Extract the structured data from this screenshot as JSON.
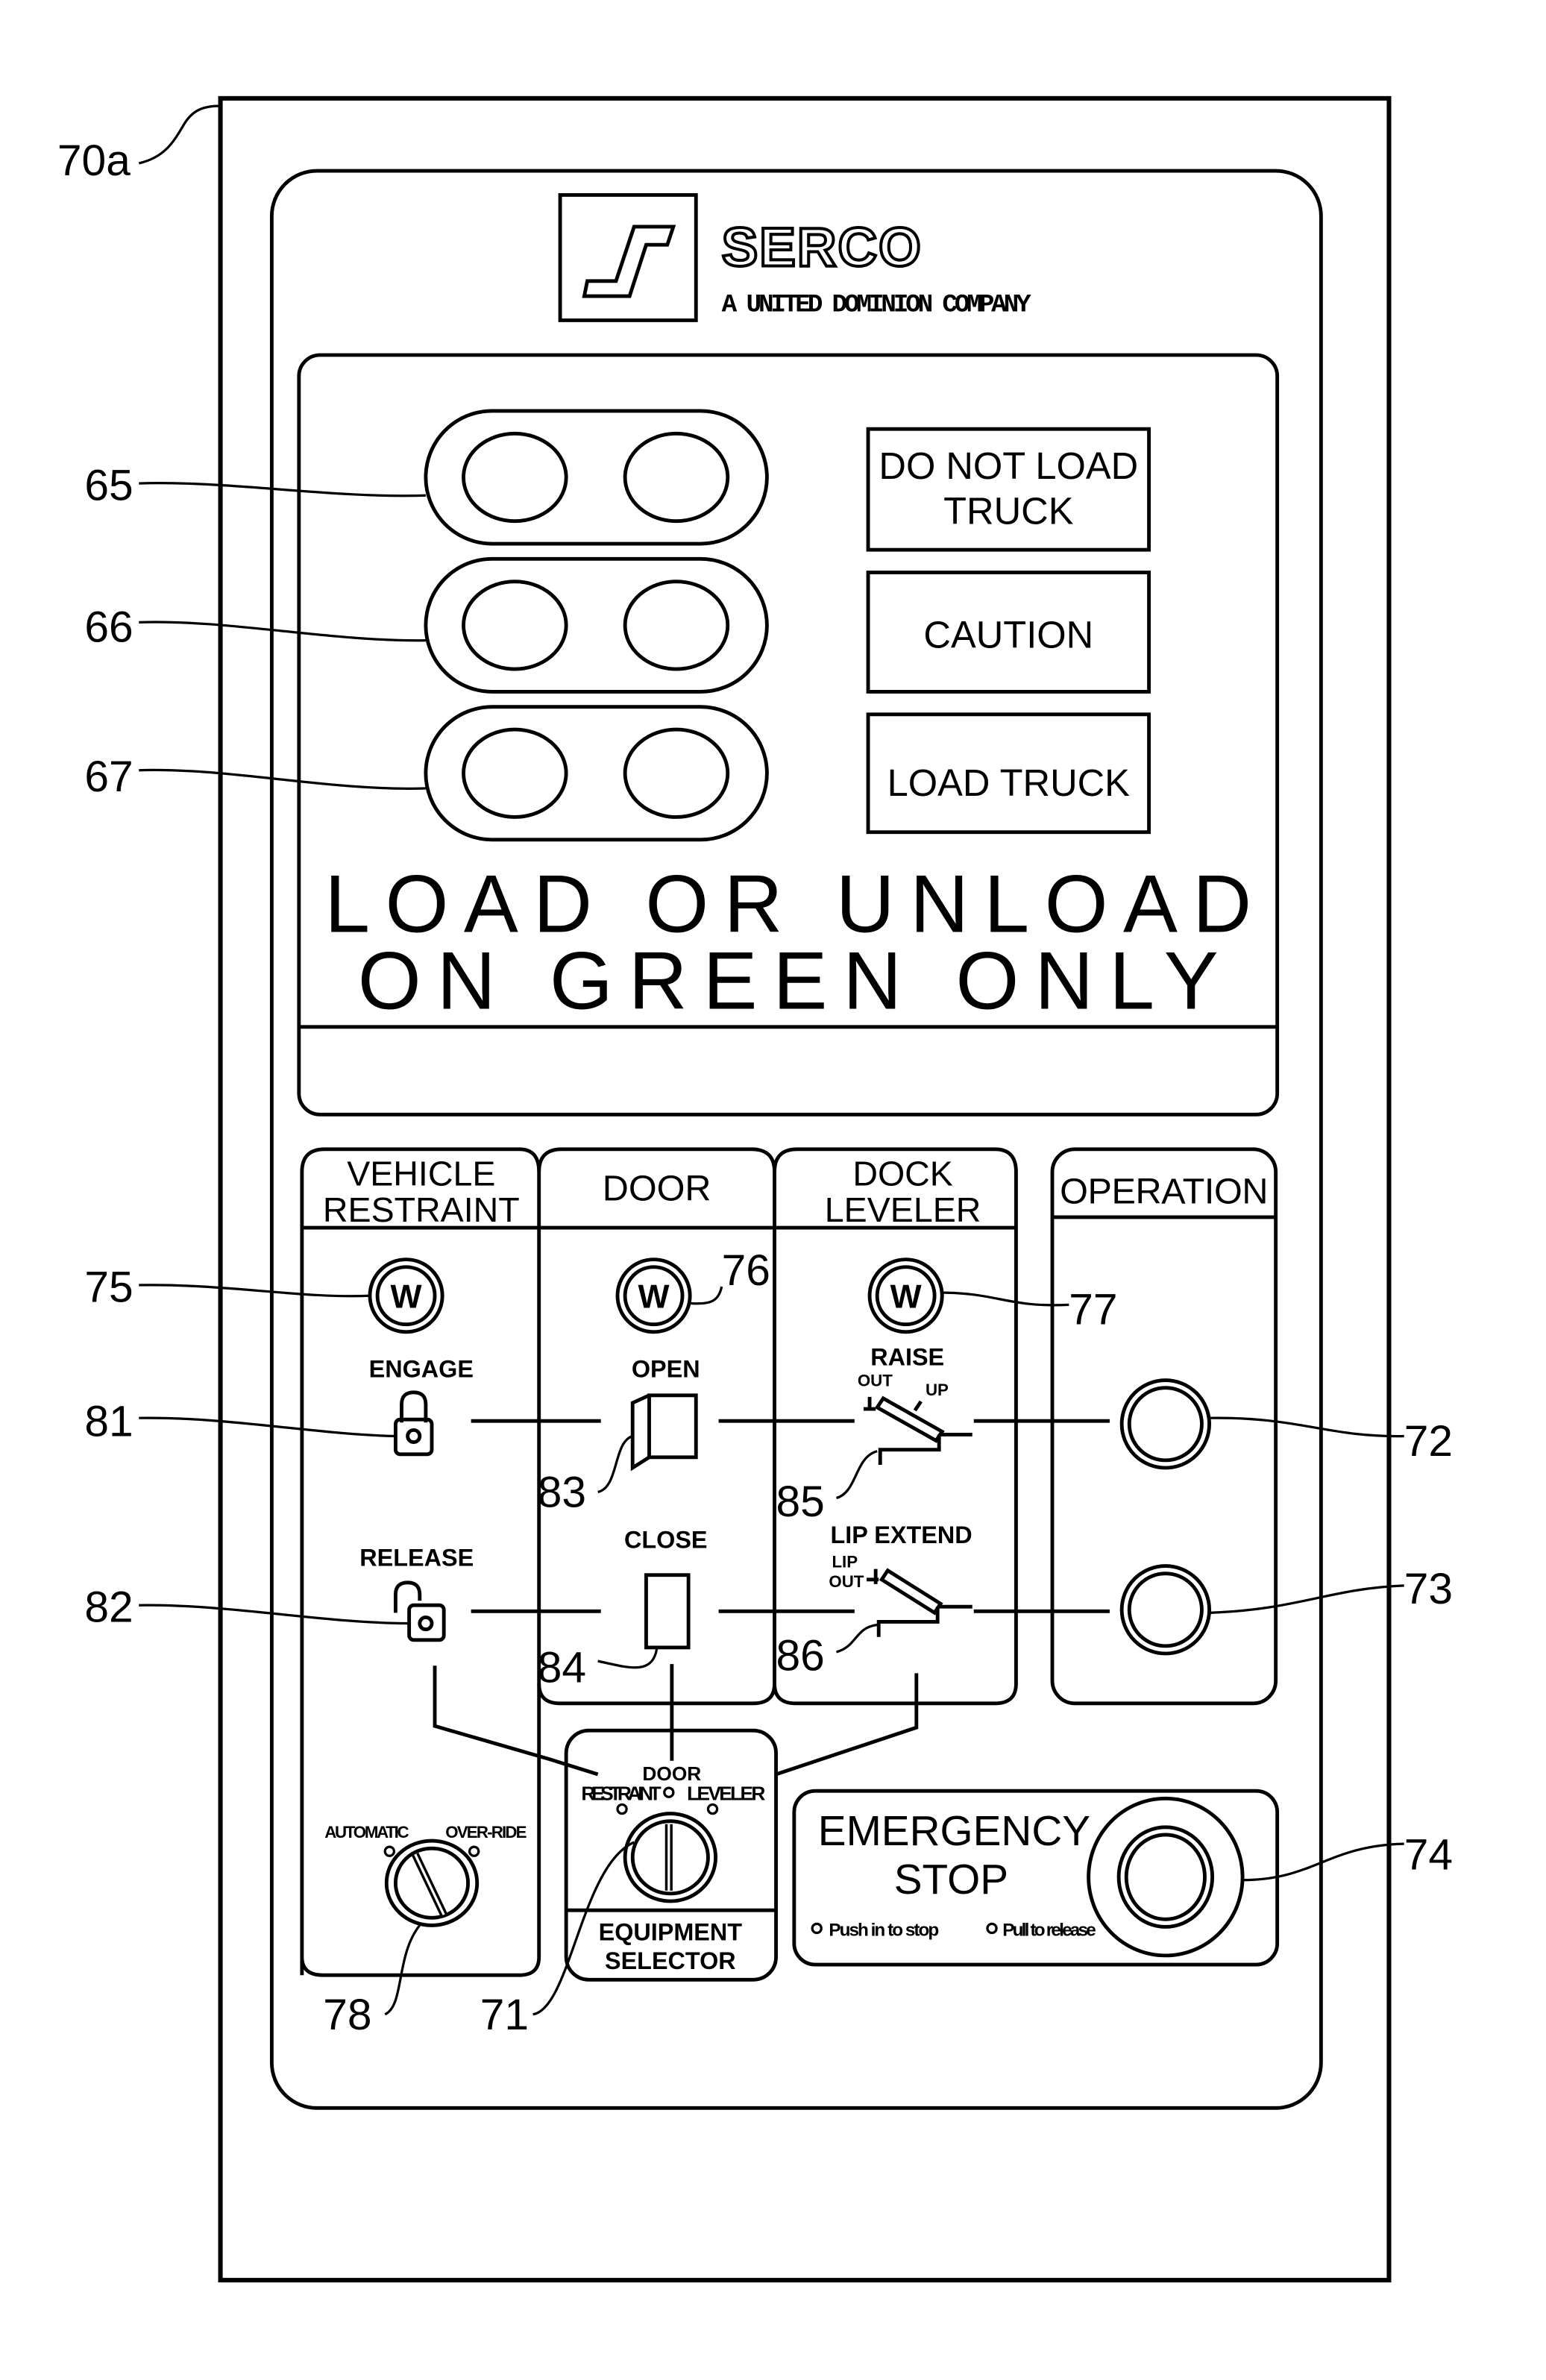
{
  "figure": {
    "panel_ref": "70a",
    "brand": {
      "name": "SERCO",
      "tagline": "A UNITED DOMINION COMPANY",
      "logo_icon": "serco-s-logo-icon"
    },
    "signal_lights": [
      {
        "ref": "65",
        "label_line1": "DO NOT LOAD",
        "label_line2": "TRUCK"
      },
      {
        "ref": "66",
        "label_line1": "CAUTION",
        "label_line2": ""
      },
      {
        "ref": "67",
        "label_line1": "LOAD TRUCK",
        "label_line2": ""
      }
    ],
    "instruction": {
      "line1": "LOAD OR UNLOAD",
      "line2": "ON GREEN ONLY"
    },
    "sections": {
      "vehicle_restraint": {
        "title_line1": "VEHICLE",
        "title_line2": "RESTRAINT",
        "indicator_ref": "75",
        "indicator_letter": "W",
        "engage_label": "ENGAGE",
        "engage_ref": "81",
        "release_label": "RELEASE",
        "release_ref": "82",
        "mode_switch": {
          "ref": "78",
          "option_left": "AUTOMATIC",
          "option_right": "OVER-RIDE"
        }
      },
      "door": {
        "title": "DOOR",
        "indicator_ref": "76",
        "indicator_letter": "W",
        "open_label": "OPEN",
        "open_ref": "83",
        "close_label": "CLOSE",
        "close_ref": "84"
      },
      "dock_leveler": {
        "title_line1": "DOCK",
        "title_line2": "LEVELER",
        "indicator_ref": "77",
        "indicator_letter": "W",
        "raise_label": "RAISE",
        "raise_out": "OUT",
        "raise_up": "UP",
        "raise_ref": "85",
        "lip_label": "LIP EXTEND",
        "lip_lip": "LIP",
        "lip_out": "OUT",
        "lip_ref": "86"
      },
      "operation": {
        "title": "OPERATION",
        "button1_ref": "72",
        "button2_ref": "73"
      },
      "equipment_selector": {
        "ref": "71",
        "pos_top": "DOOR",
        "pos_left": "RESTRAINT",
        "pos_right": "LEVELER",
        "title_line1": "EQUIPMENT",
        "title_line2": "SELECTOR"
      },
      "emergency_stop": {
        "ref": "74",
        "title_line1": "EMERGENCY",
        "title_line2": "STOP",
        "hint_left": "Push in to stop",
        "hint_right": "Pull to release"
      }
    }
  }
}
